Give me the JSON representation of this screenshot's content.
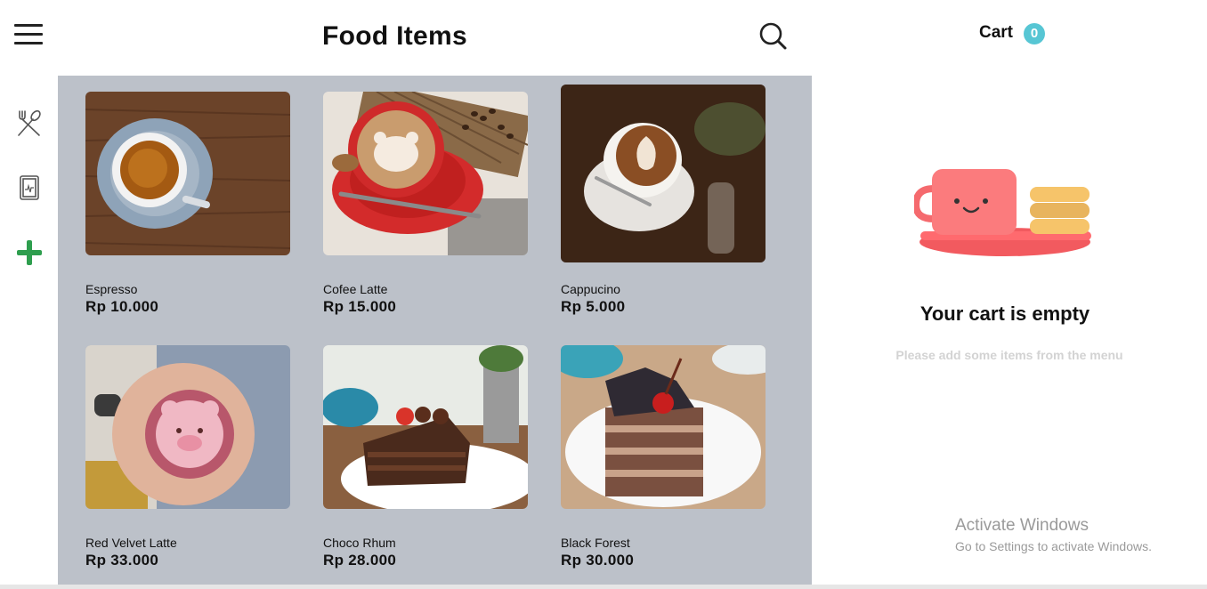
{
  "header": {
    "title": "Food Items"
  },
  "sidebar": {
    "items": [
      "menu-icon",
      "history-icon",
      "add-icon"
    ]
  },
  "products": [
    {
      "name": "Espresso",
      "price": "Rp 10.000"
    },
    {
      "name": "Cofee Latte",
      "price": "Rp 15.000"
    },
    {
      "name": "Cappucino",
      "price": "Rp 5.000"
    },
    {
      "name": "Red Velvet Latte",
      "price": "Rp 33.000"
    },
    {
      "name": "Choco Rhum",
      "price": "Rp 28.000"
    },
    {
      "name": "Black Forest",
      "price": "Rp 30.000"
    }
  ],
  "cart": {
    "title": "Cart",
    "count": "0",
    "empty_title": "Your cart is empty",
    "empty_subtitle": "Please add some items from the menu"
  },
  "watermark": {
    "title": "Activate Windows",
    "subtitle": "Go to Settings to activate Windows."
  },
  "colors": {
    "accent": "#57c6d4",
    "add": "#2e9e4e",
    "grid_bg": "#bcc1c9"
  }
}
